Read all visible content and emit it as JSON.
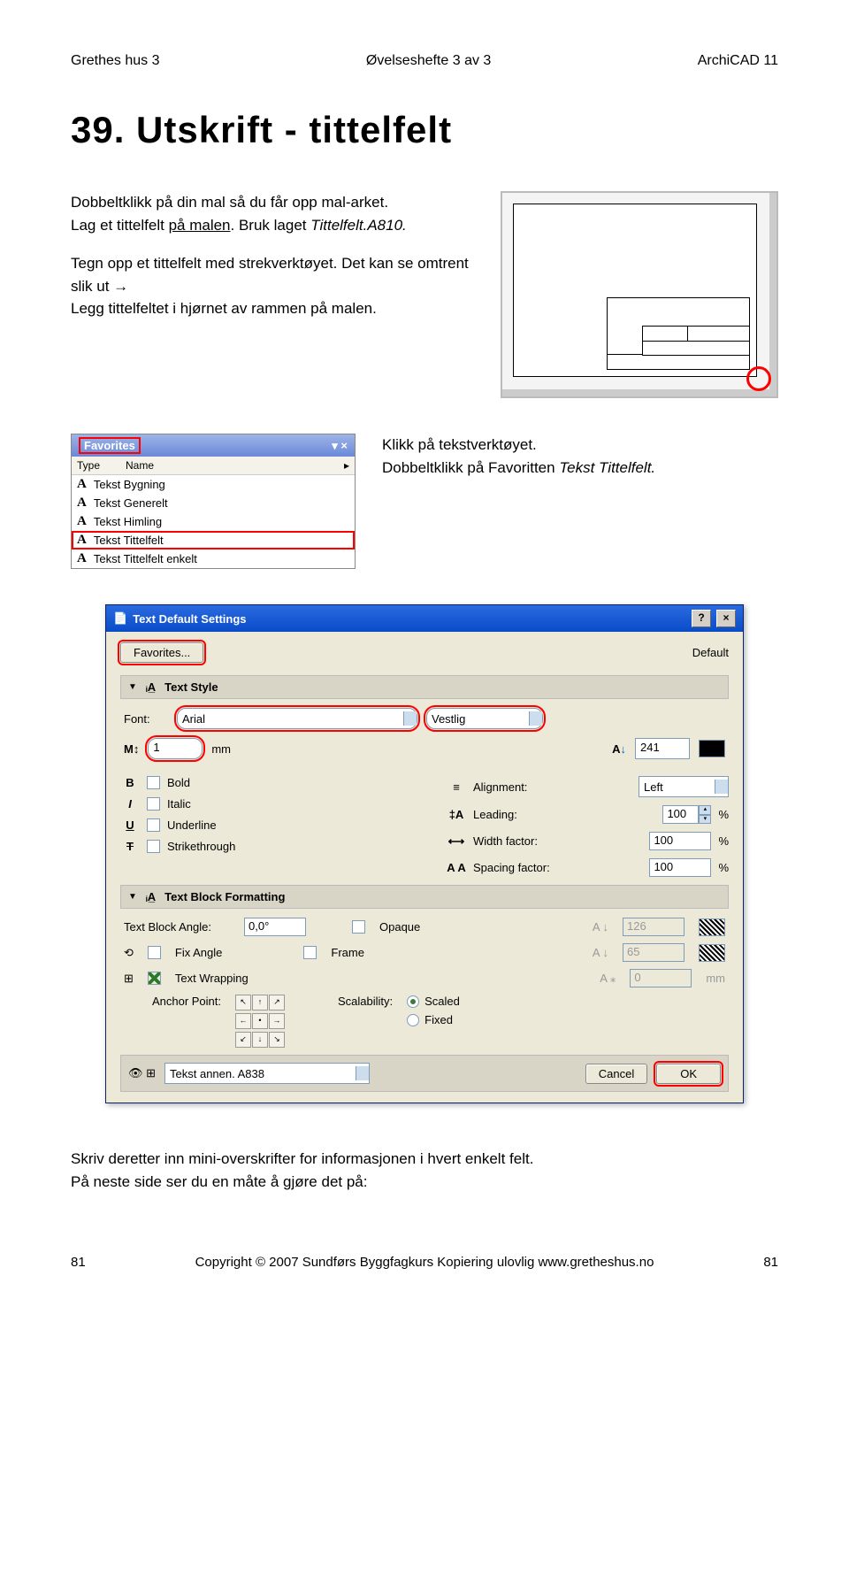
{
  "header": {
    "left": "Grethes hus 3",
    "center": "Øvelseshefte 3 av 3",
    "right": "ArchiCAD 11"
  },
  "title": "39. Utskrift - tittelfelt",
  "intro": {
    "p1a": "Dobbeltklikk på din mal så du får opp mal-arket.",
    "p1b": "Lag et tittelfelt ",
    "p1c": "på malen",
    "p1d": ". Bruk laget ",
    "p1e": "Tittelfelt.A810.",
    "p2a": "Tegn opp et tittelfelt med strekverktøyet. Det kan se omtrent slik ut →",
    "p2b": "Legg tittelfeltet i hjørnet av rammen på malen."
  },
  "fav": {
    "title": "Favorites",
    "col1": "Type",
    "col2": "Name",
    "items": [
      "Tekst Bygning",
      "Tekst Generelt",
      "Tekst Himling",
      "Tekst Tittelfelt",
      "Tekst Tittelfelt enkelt"
    ],
    "text1": "Klikk på tekstverktøyet.",
    "text2a": "Dobbeltklikk på Favoritten ",
    "text2b": "Tekst Tittelfelt."
  },
  "dlg": {
    "title": "Text Default Settings",
    "favbtn": "Favorites...",
    "default": "Default",
    "sec1": "Text Style",
    "sec2": "Text Block Formatting",
    "font_lbl": "Font:",
    "font_val": "Arial",
    "script": "Vestlig",
    "size_ico": "M↕",
    "size_val": "1",
    "size_unit": "mm",
    "color_ico": "A",
    "color_val": "241",
    "bold": "Bold",
    "italic": "Italic",
    "underline": "Underline",
    "strike": "Strikethrough",
    "align_lbl": "Alignment:",
    "align_val": "Left",
    "lead_lbl": "Leading:",
    "lead_val": "100",
    "pct": "%",
    "width_lbl": "Width factor:",
    "width_val": "100",
    "space_lbl": "Spacing factor:",
    "space_val": "100",
    "angle_lbl": "Text Block Angle:",
    "angle_val": "0,0°",
    "fix": "Fix Angle",
    "wrap": "Text Wrapping",
    "anchor_lbl": "Anchor Point:",
    "opaque": "Opaque",
    "frame": "Frame",
    "bg_val": "126",
    "pen_val": "65",
    "off_val": "0",
    "off_unit": "mm",
    "scal_lbl": "Scalability:",
    "scaled": "Scaled",
    "fixed": "Fixed",
    "layer": "Tekst annen. A838",
    "cancel": "Cancel",
    "ok": "OK"
  },
  "outro": {
    "p1": "Skriv deretter inn mini-overskrifter for informasjonen i hvert enkelt felt.",
    "p2": "På neste side ser du en måte å gjøre det på:"
  },
  "footer": {
    "left": "81",
    "mid": "Copyright © 2007   Sundførs Byggfagkurs   Kopiering ulovlig   www.gretheshus.no",
    "right": "81"
  }
}
